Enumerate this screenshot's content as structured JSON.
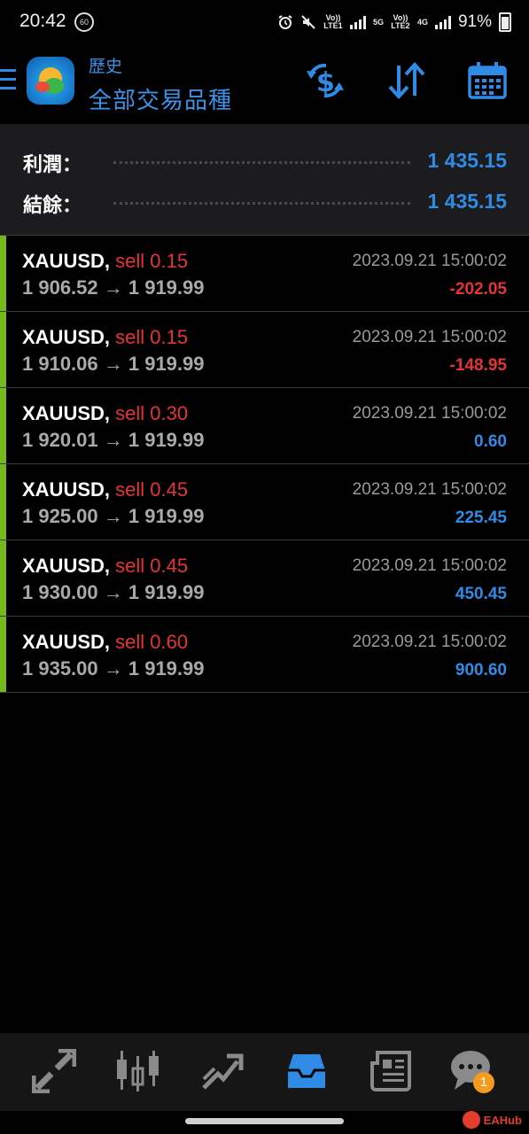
{
  "status": {
    "time": "20:42",
    "ico60": "60",
    "volte1": "Vo)) LTE1",
    "net5g": "5G",
    "volte2": "Vo)) LTE2",
    "net4g": "4G",
    "battery": "91%"
  },
  "header": {
    "subtitle": "歷史",
    "title": "全部交易品種"
  },
  "summary": {
    "profit_label": "利潤：",
    "profit_value": "1 435.15",
    "balance_label": "結餘：",
    "balance_value": "1 435.15"
  },
  "deals": [
    {
      "symbol": "XAUUSD,",
      "side": "sell 0.15",
      "time": "2023.09.21 15:00:02",
      "prices": "1 906.52 → 1 919.99",
      "profit": "-202.05",
      "sign": "neg"
    },
    {
      "symbol": "XAUUSD,",
      "side": "sell 0.15",
      "time": "2023.09.21 15:00:02",
      "prices": "1 910.06 → 1 919.99",
      "profit": "-148.95",
      "sign": "neg"
    },
    {
      "symbol": "XAUUSD,",
      "side": "sell 0.30",
      "time": "2023.09.21 15:00:02",
      "prices": "1 920.01 → 1 919.99",
      "profit": "0.60",
      "sign": "pos"
    },
    {
      "symbol": "XAUUSD,",
      "side": "sell 0.45",
      "time": "2023.09.21 15:00:02",
      "prices": "1 925.00 → 1 919.99",
      "profit": "225.45",
      "sign": "pos"
    },
    {
      "symbol": "XAUUSD,",
      "side": "sell 0.45",
      "time": "2023.09.21 15:00:02",
      "prices": "1 930.00 → 1 919.99",
      "profit": "450.45",
      "sign": "pos"
    },
    {
      "symbol": "XAUUSD,",
      "side": "sell 0.60",
      "time": "2023.09.21 15:00:02",
      "prices": "1 935.00 → 1 919.99",
      "profit": "900.60",
      "sign": "pos"
    }
  ],
  "nav": {
    "chat_badge": "1",
    "icons": [
      "quotes-icon",
      "chart-icon",
      "trade-icon",
      "history-icon",
      "news-icon",
      "chat-icon"
    ]
  },
  "watermark": "EAHub",
  "colors": {
    "accent": "#2f8be6",
    "negative": "#e5333a",
    "positive": "#2f8be6",
    "deal_bar": "#74b81a",
    "badge": "#f39a1f"
  }
}
